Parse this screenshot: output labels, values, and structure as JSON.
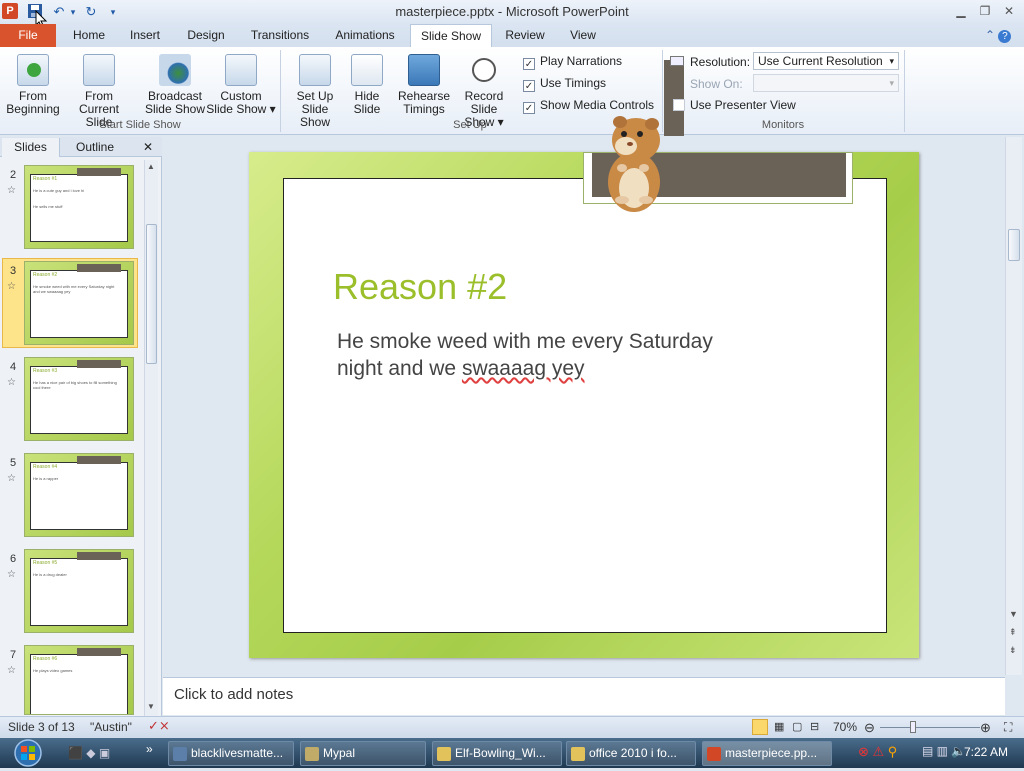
{
  "window": {
    "title": "masterpiece.pptx - Microsoft PowerPoint",
    "app_icon": "P"
  },
  "tabs": {
    "file": "File",
    "items": [
      "Home",
      "Insert",
      "Design",
      "Transitions",
      "Animations",
      "Slide Show",
      "Review",
      "View"
    ],
    "active": "Slide Show"
  },
  "ribbon": {
    "start_group": {
      "label": "Start Slide Show",
      "from_beginning": [
        "From",
        "Beginning"
      ],
      "from_current": [
        "From",
        "Current Slide"
      ],
      "broadcast": [
        "Broadcast",
        "Slide Show"
      ],
      "custom": [
        "Custom",
        "Slide Show ▾"
      ]
    },
    "setup_group": {
      "label": "Set Up",
      "setup": [
        "Set Up",
        "Slide Show"
      ],
      "hide": [
        "Hide",
        "Slide"
      ],
      "rehearse": [
        "Rehearse",
        "Timings"
      ],
      "record": [
        "Record Slide",
        "Show ▾"
      ]
    },
    "checks": {
      "play_narrations": "Play Narrations",
      "use_timings": "Use Timings",
      "show_media_controls": "Show Media Controls",
      "checked_mark": "✓"
    },
    "monitors": {
      "label": "Monitors",
      "resolution_label": "Resolution:",
      "resolution_value": "Use Current Resolution",
      "show_on_label": "Show On:",
      "presenter_view": "Use Presenter View"
    }
  },
  "pane": {
    "tab_slides": "Slides",
    "tab_outline": "Outline",
    "close": "✕",
    "thumbs": [
      {
        "num": "2",
        "title": "Reason #1",
        "l1": "He is a cute guy and i love hi",
        "l2": "He sells me stuff"
      },
      {
        "num": "3",
        "title": "Reason #2",
        "l1": "He smoke weed with me every Saturday night and we swaaaag yey",
        "l2": ""
      },
      {
        "num": "4",
        "title": "Reason #3",
        "l1": "He has a nice pair of big shoes to fill something cool there",
        "l2": ""
      },
      {
        "num": "5",
        "title": "Reason #4",
        "l1": "He is a rapper",
        "l2": ""
      },
      {
        "num": "6",
        "title": "Reason #5",
        "l1": "He is a drug dealer",
        "l2": ""
      },
      {
        "num": "7",
        "title": "Reason #6",
        "l1": "He plays video games",
        "l2": ""
      }
    ]
  },
  "slide": {
    "title": "Reason #2",
    "body_line1": "He smoke weed with me every Saturday",
    "body_line2_a": "night and we ",
    "body_line2_b": "swaaaag yey"
  },
  "notes": {
    "placeholder": "Click to add notes"
  },
  "status": {
    "slide_info": "Slide 3 of 13",
    "theme": "\"Austin\"",
    "zoom": "70%"
  },
  "taskbar": {
    "items": [
      "blacklivesmatte...",
      "Mypal",
      "Elf-Bowling_Wi...",
      "office 2010 i fo...",
      "masterpiece.pp..."
    ],
    "active_index": 4,
    "clock": "7:22 AM"
  },
  "colors": {
    "accent": "#9bbf2b",
    "file_tab": "#d9532c",
    "title_bar": "#6b6257"
  }
}
